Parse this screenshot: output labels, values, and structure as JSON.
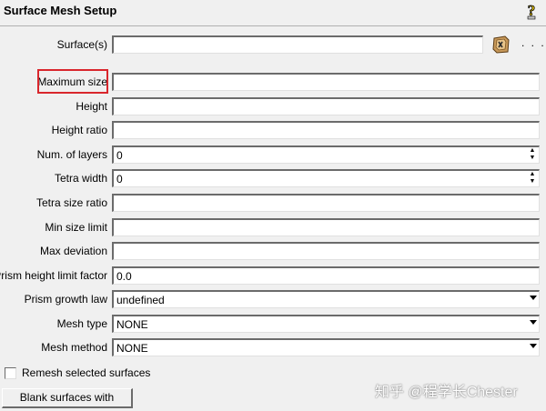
{
  "title": "Surface Mesh Setup",
  "fields": {
    "surfaces": {
      "label": "Surface(s)",
      "value": ""
    },
    "max_size": {
      "label": "Maximum size",
      "value": ""
    },
    "height": {
      "label": "Height",
      "value": ""
    },
    "height_ratio": {
      "label": "Height ratio",
      "value": ""
    },
    "num_layers": {
      "label": "Num. of layers",
      "value": "0"
    },
    "tetra_width": {
      "label": "Tetra width",
      "value": "0"
    },
    "tetra_size_ratio": {
      "label": "Tetra size ratio",
      "value": ""
    },
    "min_size_limit": {
      "label": "Min size limit",
      "value": ""
    },
    "max_deviation": {
      "label": "Max deviation",
      "value": ""
    },
    "prism_height_limit": {
      "label": "Prism height limit factor",
      "value": "0.0"
    },
    "prism_growth_law": {
      "label": "Prism growth law",
      "value": "undefined"
    },
    "mesh_type": {
      "label": "Mesh type",
      "value": "NONE"
    },
    "mesh_method": {
      "label": "Mesh method",
      "value": "NONE"
    }
  },
  "more_label": ". . .",
  "remesh_checkbox": {
    "label": "Remesh selected surfaces",
    "checked": false
  },
  "blank_button": {
    "label": "Blank surfaces with params"
  },
  "watermark": "知乎 @程学长Chester",
  "icons": {
    "help": "help-question-icon",
    "select": "select-surface-icon"
  },
  "colors": {
    "highlight": "#d9262c"
  }
}
